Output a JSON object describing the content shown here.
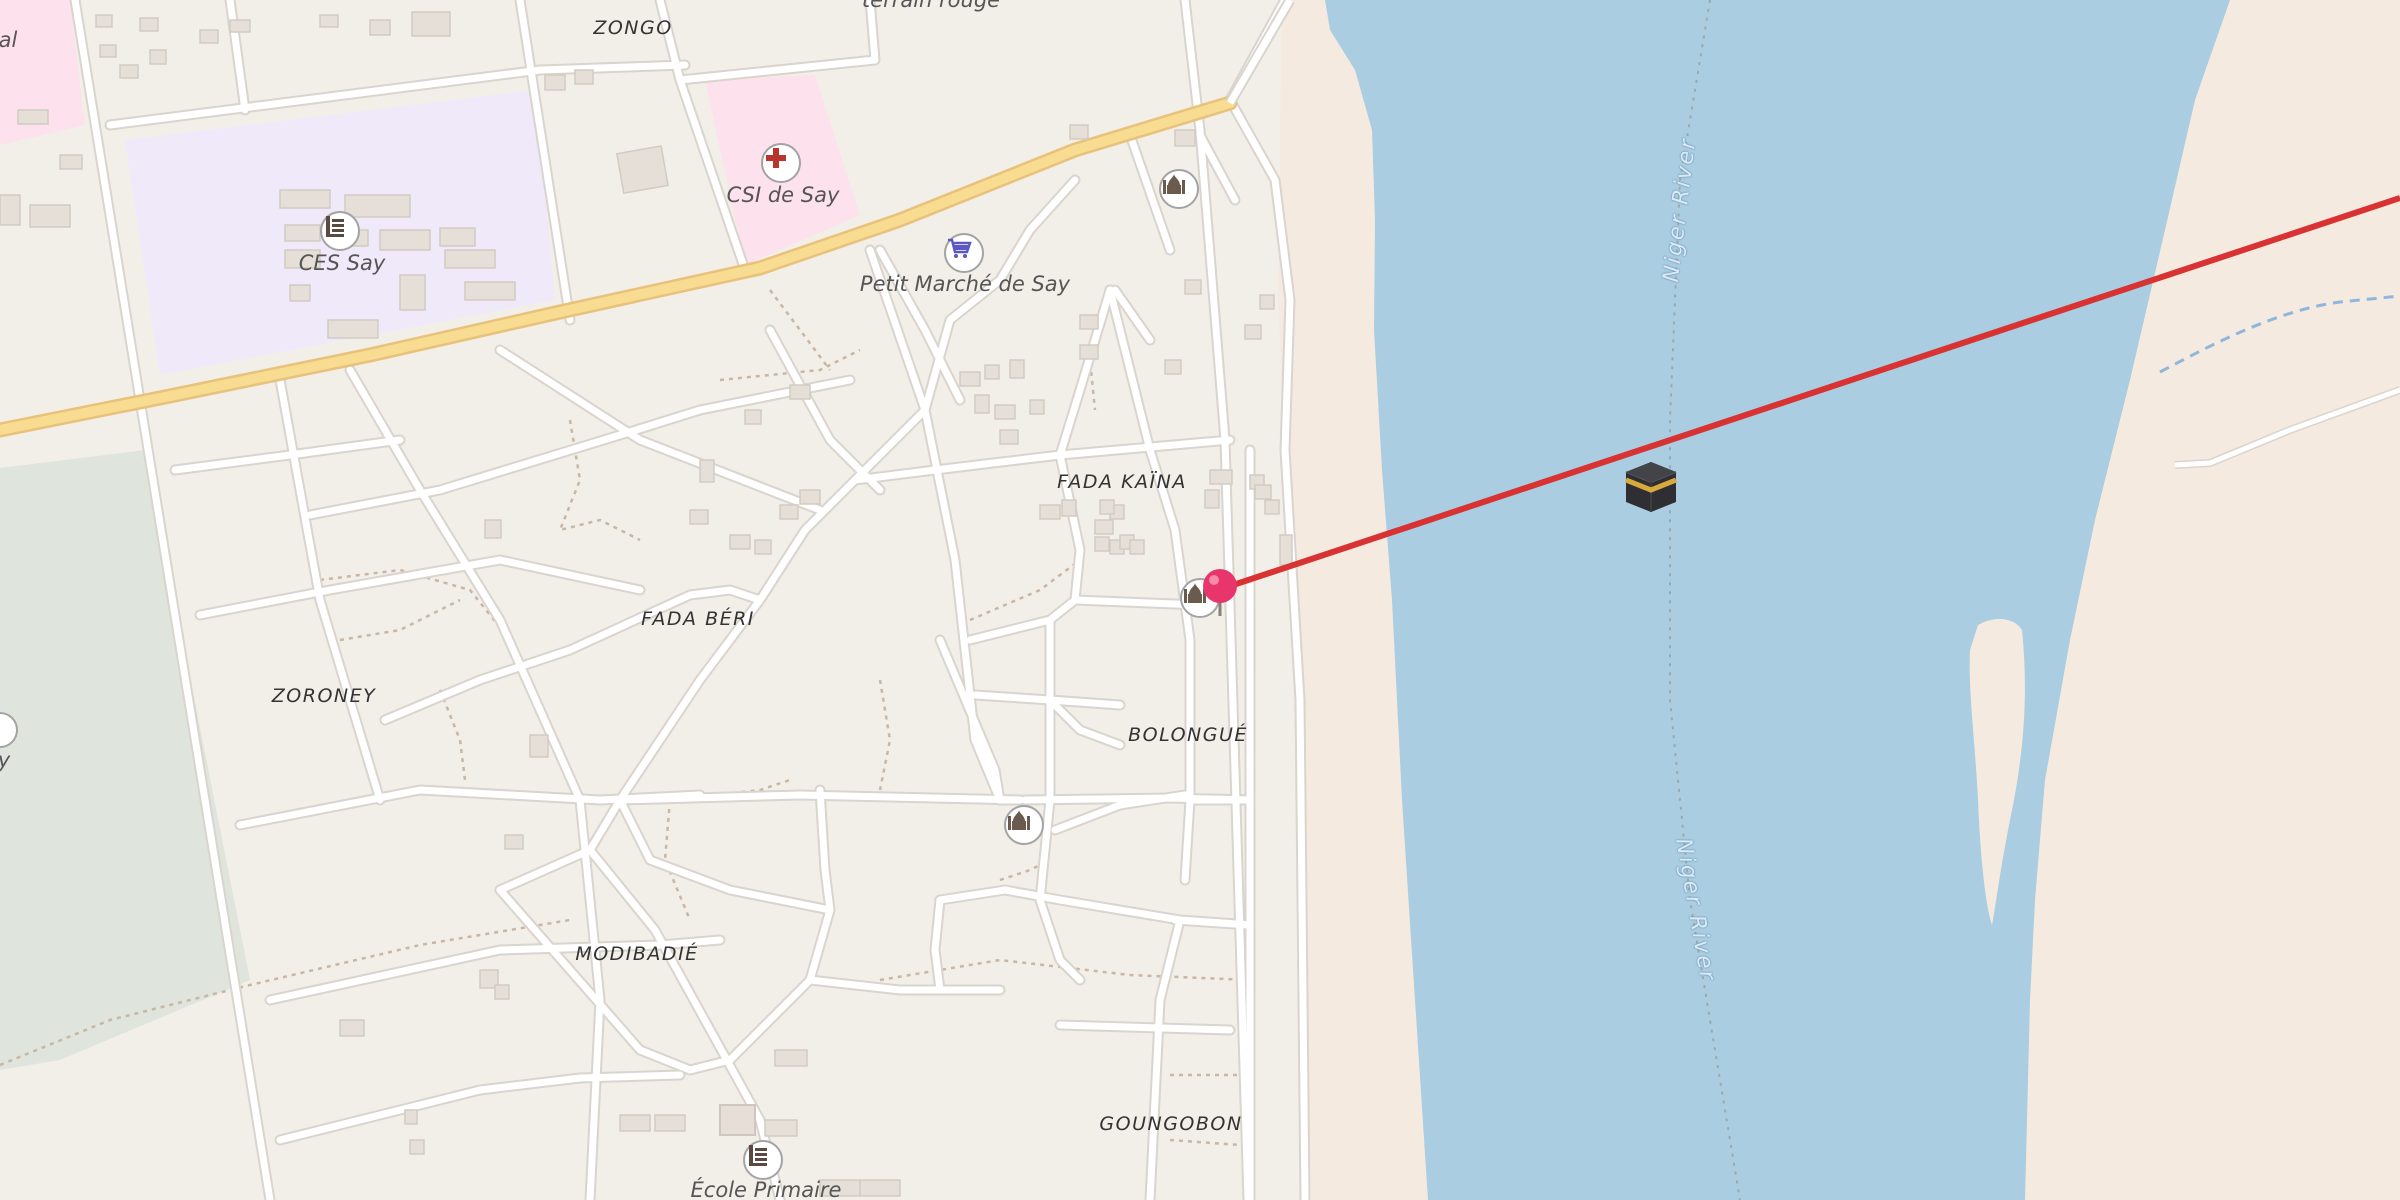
{
  "map": {
    "place_labels": {
      "zongo": "ZONGO",
      "fada_kaina": "FADA KAÏNA",
      "fada_beri": "FADA BÉRI",
      "zoroney": "ZORONEY",
      "bolongue": "BOLONGUÉ",
      "modibadie": "MODIBADIÉ",
      "goungobon": "GOUNGOBON"
    },
    "poi_labels": {
      "csi": "CSI de Say",
      "ces": "CES Say",
      "market": "Petit Marché de Say",
      "ecole": "École Primaire",
      "terrain": "terrain rouge",
      "edge_left_top": "al",
      "edge_left_mid": "y"
    },
    "river_labels": {
      "upper": "Niger River",
      "lower": "Niger River"
    },
    "icons": {
      "hospital": "hospital-cross-icon",
      "school": "school-icon",
      "market": "shopping-cart-icon",
      "mosque": "mosque-icon",
      "kaaba": "kaaba-icon",
      "pin": "location-pin-icon"
    },
    "colors": {
      "land": "#f2efe9",
      "water": "#aacde2",
      "sand": "#f5e9dc",
      "hospital_area": "#fde1ec",
      "school_area": "#efe9f9",
      "park": "#dfe4dc",
      "primary_road": "#f8dc92",
      "qibla_line": "#d83232",
      "pin": "#e8366d"
    }
  }
}
